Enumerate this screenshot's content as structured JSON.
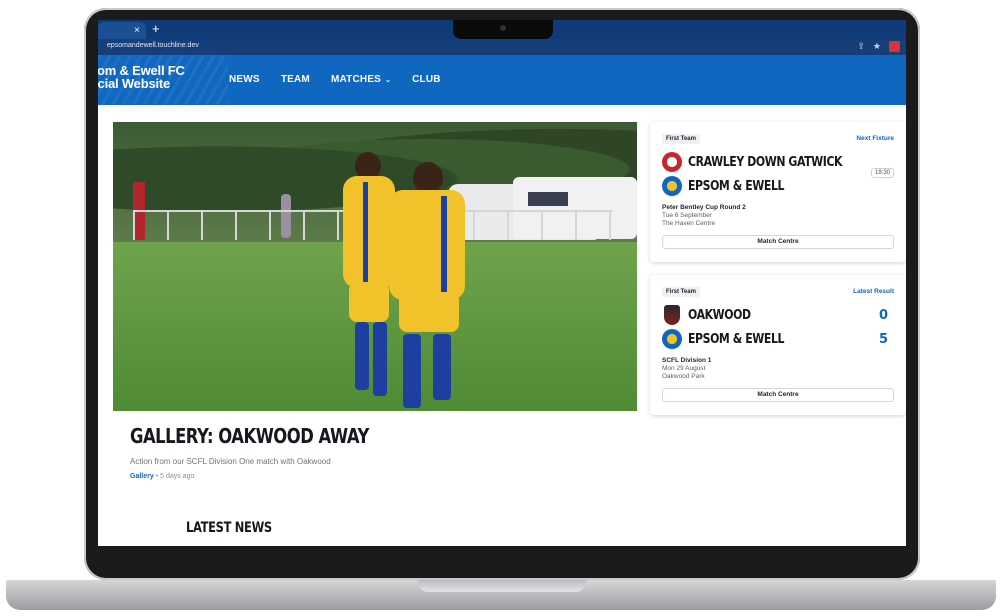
{
  "browser": {
    "tab_close": "×",
    "tab_new": "+",
    "url": "epsomandewell.touchline.dev"
  },
  "header": {
    "brand_line1": "som & Ewell FC",
    "brand_line2": "ficial Website",
    "nav": [
      {
        "label": "NEWS"
      },
      {
        "label": "TEAM"
      },
      {
        "label": "MATCHES"
      },
      {
        "label": "CLUB"
      }
    ]
  },
  "hero": {
    "title": "GALLERY: OAKWOOD AWAY",
    "subtitle": "Action from our SCFL Division One match with Oakwood",
    "category": "Gallery",
    "separator": "•",
    "time_ago": "5 days ago"
  },
  "next_fixture": {
    "badge": "First Team",
    "link": "Next Fixture",
    "home": "CRAWLEY DOWN GATWICK",
    "away": "EPSOM & EWELL",
    "kickoff": "19:30",
    "competition": "Peter Bentley Cup Round 2",
    "date": "Tue 6 September",
    "venue": "The Haven Centre",
    "button": "Match Centre"
  },
  "latest_result": {
    "badge": "First Team",
    "link": "Latest Result",
    "home": "OAKWOOD",
    "home_score": "0",
    "away": "EPSOM & EWELL",
    "away_score": "5",
    "competition": "SCFL Division 1",
    "date": "Mon 29 August",
    "venue": "Oakwood Park",
    "button": "Match Centre"
  },
  "latest_news": {
    "heading": "LATEST NEWS"
  },
  "colors": {
    "brand_blue": "#1067bf",
    "chrome_blue": "#0f3b78",
    "kit_yellow": "#f2c22a"
  }
}
